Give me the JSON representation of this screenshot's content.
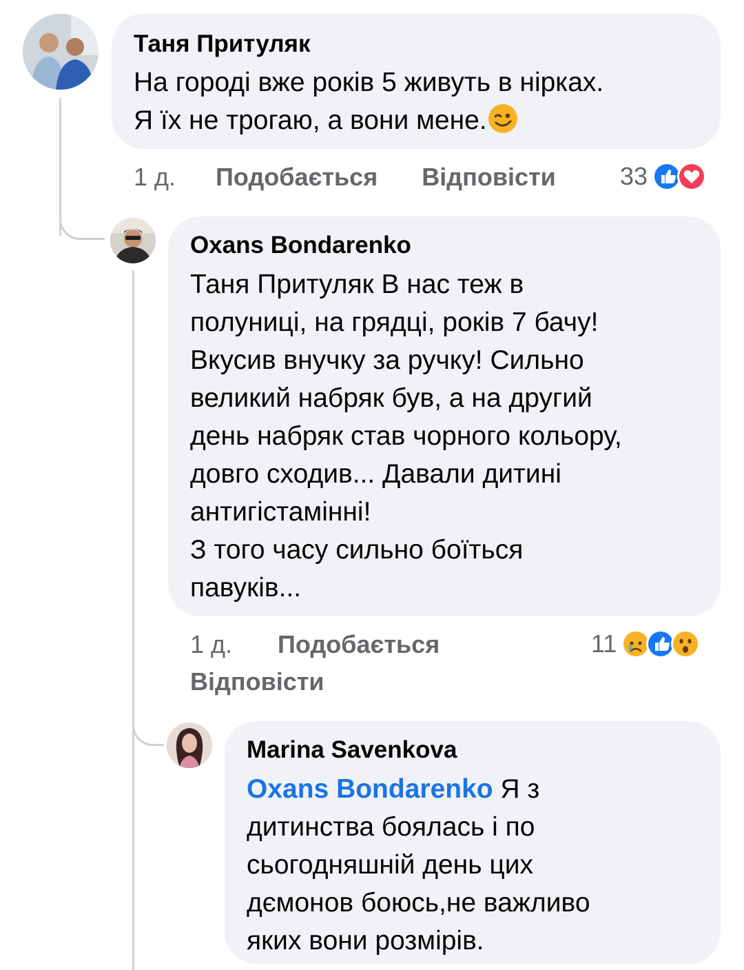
{
  "comments": [
    {
      "author": "Таня Притуляк",
      "lines": [
        "На городі вже років 5 живуть в нірках.",
        "Я їх не трогаю, а вони мене."
      ],
      "time": "1 д.",
      "like_label": "Подобається",
      "reply_label": "Відповісти",
      "reaction_count": "33",
      "reactions": [
        "like-icon",
        "love-icon"
      ]
    },
    {
      "author": "Oxans Bondarenko",
      "lines": [
        "Таня Притуляк В нас теж в",
        "полуниці, на грядці, років 7 бачу!",
        "Вкусив внучку за ручку! Сильно",
        "великий набряк був, а на другий",
        "день набряк став чорного кольору,",
        "довго сходив... Давали дитині",
        "антигістамінні!",
        "З того часу сильно боїться",
        "павуків..."
      ],
      "time": "1 д.",
      "like_label": "Подобається",
      "reply_label": "Відповісти",
      "reaction_count": "11",
      "reactions": [
        "sad-icon",
        "like-icon",
        "wow-icon"
      ]
    },
    {
      "author": "Marina Savenkova",
      "mention": "Oxans Bondarenko",
      "lines": [
        " Я з",
        "дитинства боялась і по",
        "сьогодняшній день цих",
        "дємонов боюсь,не важливо",
        "яких вони розмірів."
      ]
    }
  ],
  "colors": {
    "bubble": "#f0f2f5",
    "secondary_text": "#65676b",
    "mention": "#1b74e4",
    "like": "#1877f2",
    "love": "#f33e58",
    "emoji": "#f7b125"
  }
}
